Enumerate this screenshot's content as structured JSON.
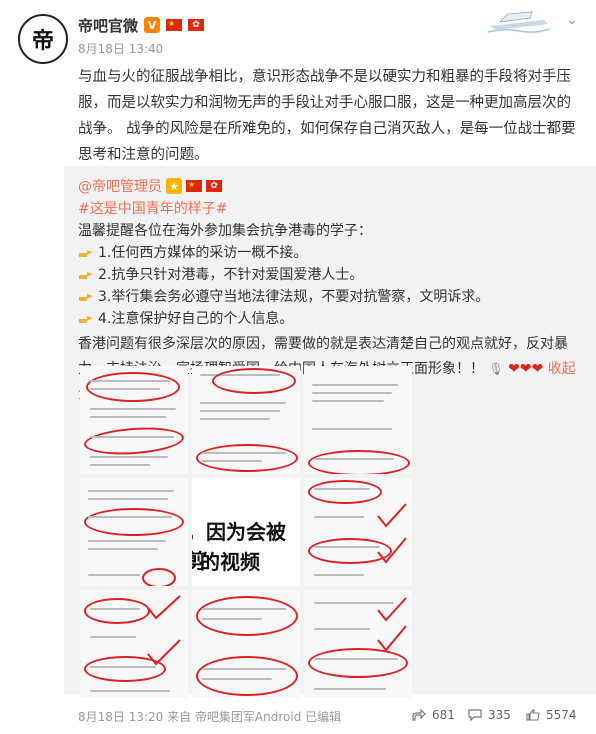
{
  "header": {
    "user_name": "帝吧官微",
    "verified_badge": "V",
    "post_time": "8月18日 13:40",
    "avatar_text": "帝"
  },
  "post": {
    "text": "与血与火的征服战争相比，意识形态战争不是以硬实力和粗暴的手段将对手压服，而是以软实力和润物无声的手段让对手心服口服，这是一种更加高层次的战争。 战争的风险是在所难免的，如何保存自己消灭敌人，是每一位战士都要思考和注意的问题。"
  },
  "repost": {
    "author": "@帝吧管理员",
    "hashtag": "#这是中国青年的样子#",
    "intro": "温馨提醒各位在海外参加集会抗争港毒的学子：",
    "items": [
      "1.任何西方媒体的采访一概不接。",
      "2.抗争只针对港毒，不针对爱国爱港人士。",
      "3.举行集会务必遵守当地法律法规，不要对抗警察，文明诉求。",
      "4.注意保护好自己的个人信息。"
    ],
    "paragraph": "香港问题有很多深层次的原因，需要做的就是表达清楚自己的观点就好，反对暴力，支持法治。宣扬理智爱国，给中国人在海外树立正面形象！！",
    "hearts": "❤❤❤",
    "collapse_label": "收起全文 ⌄"
  },
  "grid_text": {
    "big_line1": "，因为会被剪",
    "big_line2": "的视频"
  },
  "footer": {
    "meta": "8月18日 13:20 来自 帝吧集团军Android  已编辑"
  },
  "actions": {
    "repost_count": "681",
    "comment_count": "335",
    "like_count": "5574"
  },
  "colors": {
    "link": "#eb7350",
    "vip": "#ff8200",
    "markup_red": "#e02020"
  }
}
